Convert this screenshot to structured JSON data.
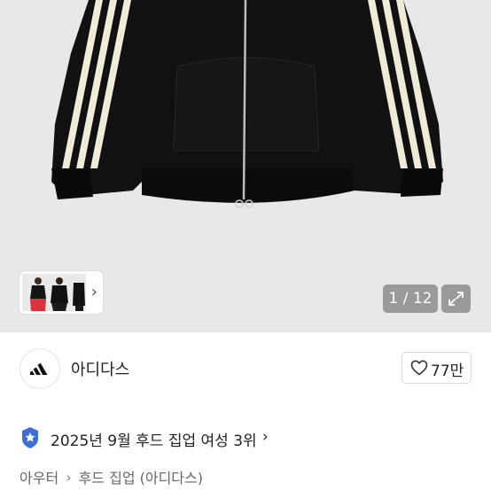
{
  "gallery": {
    "current_page": 1,
    "total_pages": 12,
    "counter_text": "1 / 12",
    "thumbnails_chevron": "›",
    "background_color": "#e8e8e9",
    "product_color": "#111111",
    "stripe_color": "#f0ead8"
  },
  "brand": {
    "name": "아디다스",
    "logo_icon": "adidas-logo-icon",
    "like_icon": "heart-outline-icon",
    "like_count": "77만"
  },
  "ranking": {
    "badge_icon": "blue-star-badge-icon",
    "badge_color": "#3d6fd6",
    "text": "2025년 9월 후드 집업 여성 3위",
    "chevron": "›"
  },
  "breadcrumb": {
    "items": [
      "아우터",
      "후드 집업 (아디다스)"
    ],
    "separator": "›"
  }
}
